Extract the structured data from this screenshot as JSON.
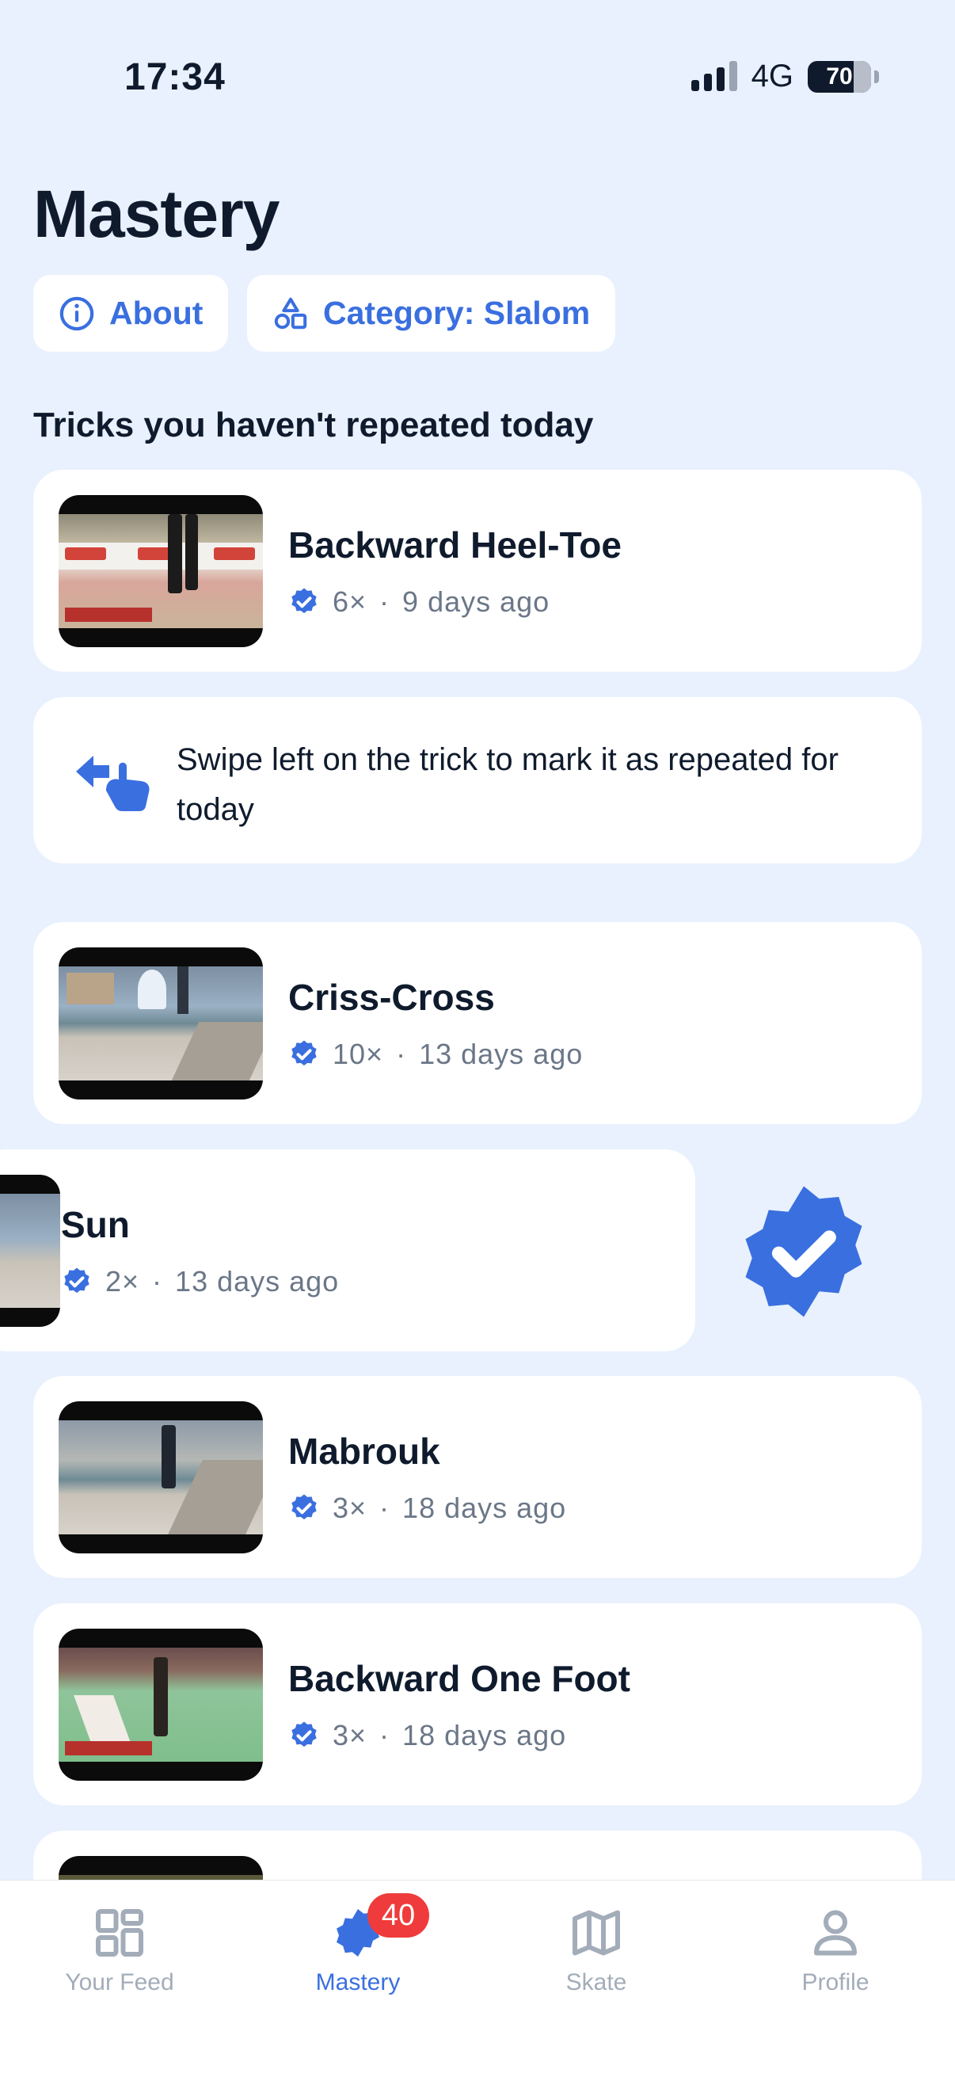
{
  "status_bar": {
    "time": "17:34",
    "network": "4G",
    "battery": "70"
  },
  "page": {
    "title": "Mastery"
  },
  "chips": {
    "about": "About",
    "category": "Category: Slalom"
  },
  "section": {
    "title": "Tricks you haven't repeated today"
  },
  "tricks": [
    {
      "name": "Backward Heel-Toe",
      "count": "6×",
      "separator": "·",
      "ago": "9 days ago"
    },
    {
      "name": "Criss-Cross",
      "count": "10×",
      "separator": "·",
      "ago": "13 days ago"
    },
    {
      "name": "Sun",
      "count": "2×",
      "separator": "·",
      "ago": "13 days ago"
    },
    {
      "name": "Mabrouk",
      "count": "3×",
      "separator": "·",
      "ago": "18 days ago"
    },
    {
      "name": "Backward One Foot",
      "count": "3×",
      "separator": "·",
      "ago": "18 days ago"
    }
  ],
  "hint": {
    "text": "Swipe left on the trick to mark it as repeated for today"
  },
  "tabbar": {
    "feed": "Your Feed",
    "mastery": "Mastery",
    "mastery_badge": "40",
    "skate": "Skate",
    "profile": "Profile"
  },
  "colors": {
    "accent": "#3a6fe0",
    "background": "#e8f1fd",
    "badge": "#ef3b3b"
  }
}
